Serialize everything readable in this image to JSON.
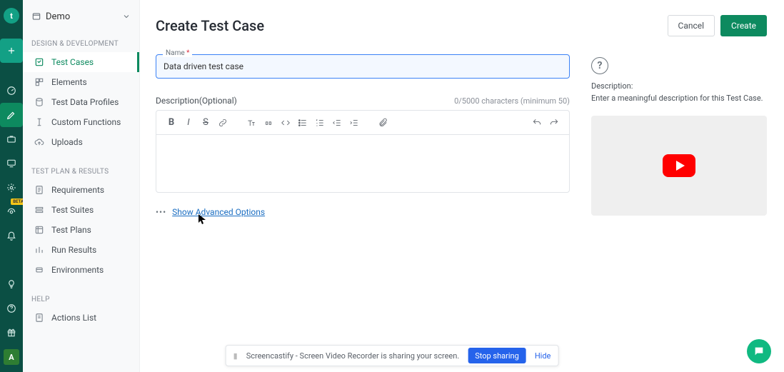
{
  "iconbar": {
    "logo_letter": "t",
    "beta_badge": "BETA",
    "avatar_initial": "A"
  },
  "project": {
    "name": "Demo"
  },
  "sidebar": {
    "section1": "DESIGN & DEVELOPMENT",
    "items1": [
      {
        "label": "Test Cases"
      },
      {
        "label": "Elements"
      },
      {
        "label": "Test Data Profiles"
      },
      {
        "label": "Custom Functions"
      },
      {
        "label": "Uploads"
      }
    ],
    "section2": "TEST PLAN & RESULTS",
    "items2": [
      {
        "label": "Requirements"
      },
      {
        "label": "Test Suites"
      },
      {
        "label": "Test Plans"
      },
      {
        "label": "Run Results"
      },
      {
        "label": "Environments"
      }
    ],
    "section3": "HELP",
    "items3": [
      {
        "label": "Actions List"
      }
    ]
  },
  "page": {
    "title": "Create Test Case",
    "cancel": "Cancel",
    "create": "Create",
    "name_label": "Name",
    "name_value": "Data driven test case",
    "desc_label": "Description(Optional)",
    "desc_counter": "0/5000 characters (minimum 50)",
    "advanced_link": "Show Advanced Options"
  },
  "info": {
    "desc_label": "Description:",
    "desc_text": "Enter a meaningful description for this Test Case."
  },
  "sharebar": {
    "text": "Screencastify - Screen Video Recorder is sharing your screen.",
    "stop": "Stop sharing",
    "hide": "Hide"
  }
}
